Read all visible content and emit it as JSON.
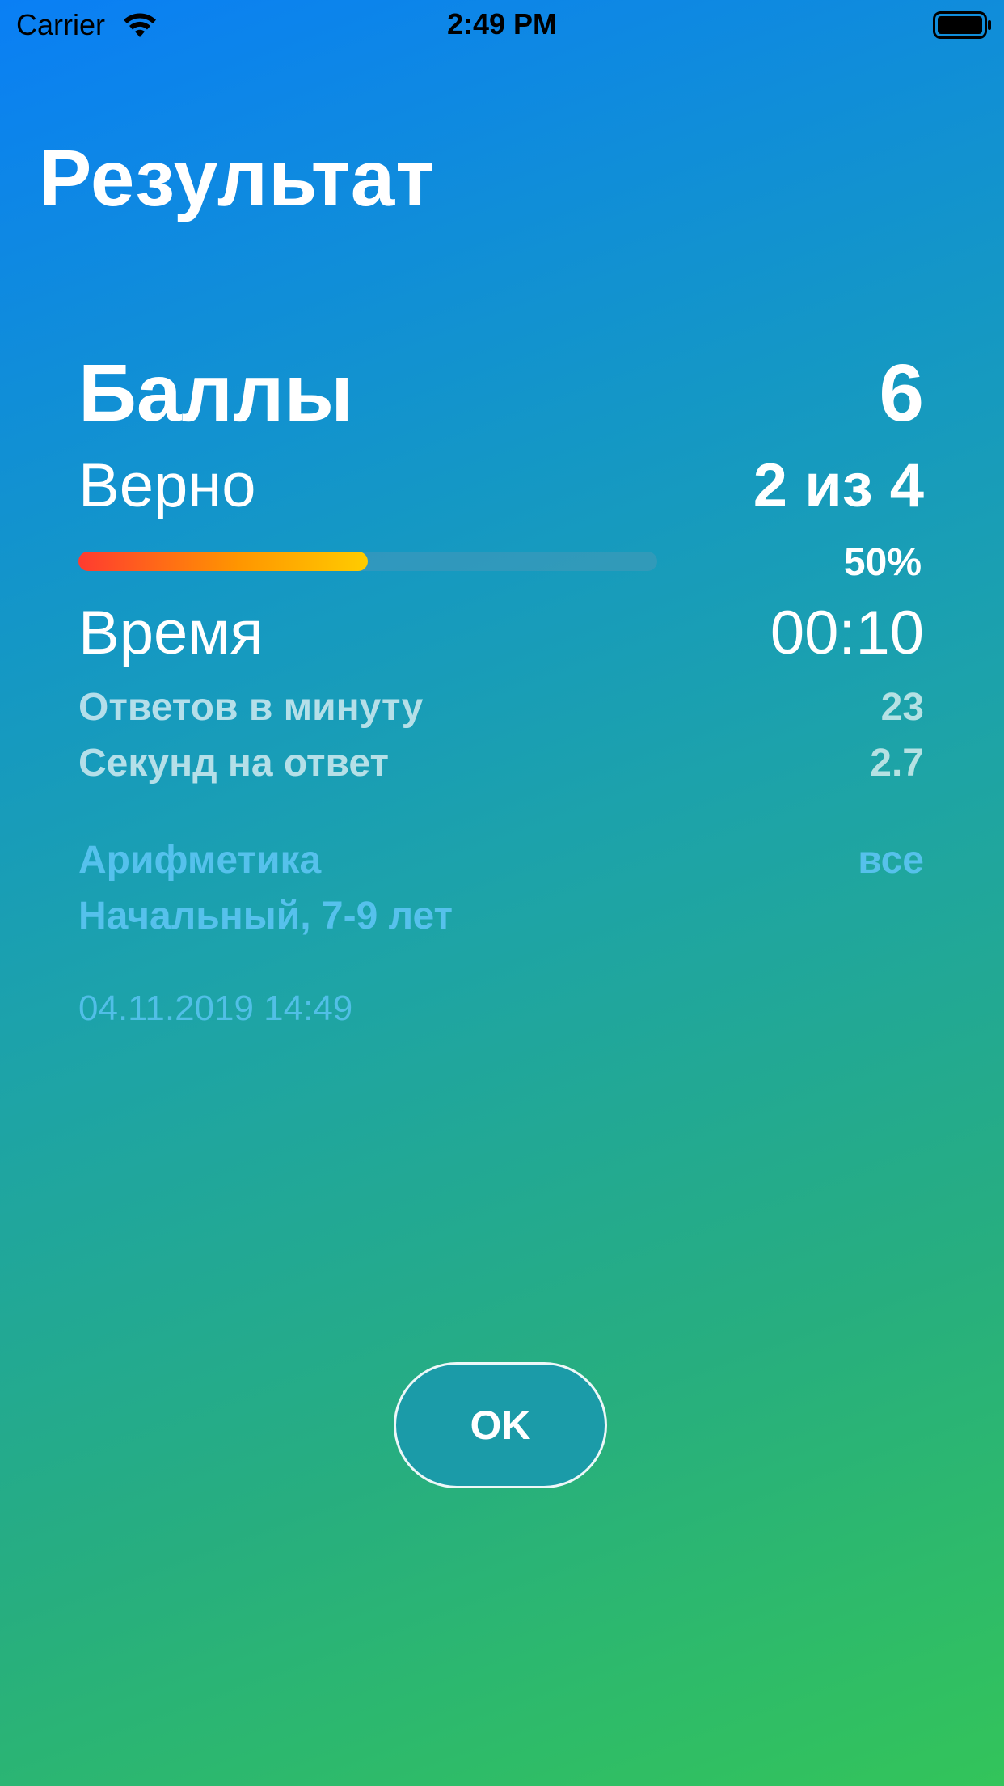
{
  "status_bar": {
    "carrier": "Carrier",
    "time": "2:49 PM",
    "wifi_icon": "wifi-icon",
    "battery_icon": "battery-icon"
  },
  "title": "Результат",
  "score": {
    "label": "Баллы",
    "value": "6"
  },
  "correct": {
    "label": "Верно",
    "value": "2 из 4",
    "percent_label": "50%",
    "progress": 0.5
  },
  "time": {
    "label": "Время",
    "value": "00:10"
  },
  "answers_per_minute": {
    "label": "Ответов в минуту",
    "value": "23"
  },
  "seconds_per_answer": {
    "label": "Секунд на ответ",
    "value": "2.7"
  },
  "category": {
    "label": "Арифметика",
    "value": "все"
  },
  "level": "Начальный, 7-9 лет",
  "date": "04.11.2019 14:49",
  "ok_button": "OK",
  "colors": {
    "gradient_start": "#0a7ff5",
    "gradient_end": "#33c45a",
    "info_text": "#5bc4f2",
    "progress_start": "#ff3b30",
    "progress_end": "#ffcc00"
  }
}
